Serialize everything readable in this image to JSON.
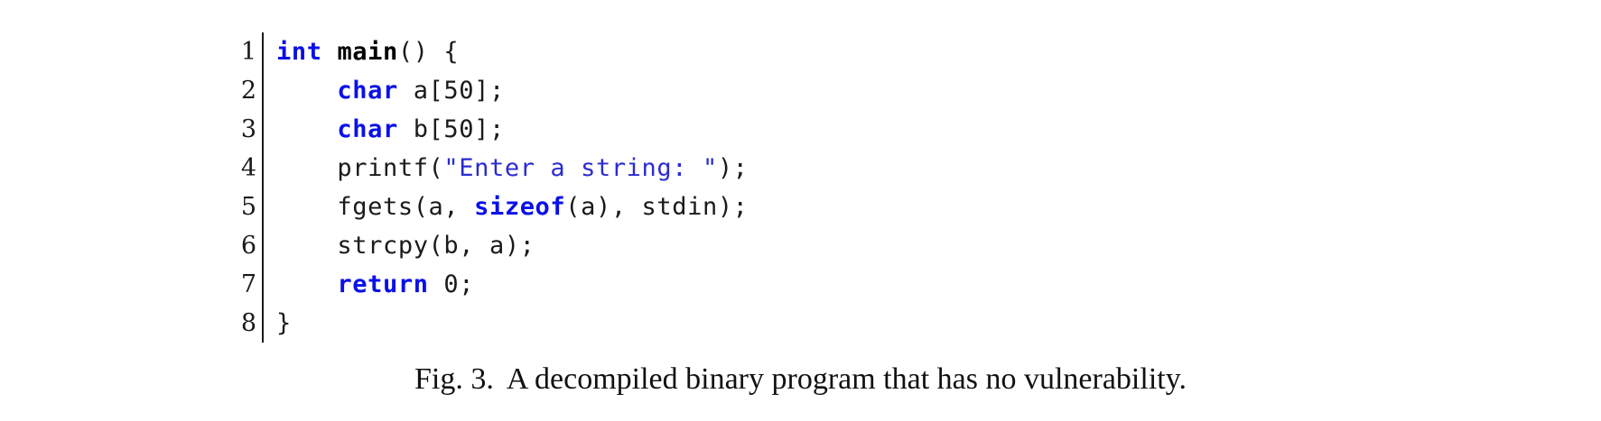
{
  "listing": {
    "lines": [
      {
        "number": "1",
        "tokens": [
          {
            "text": "int",
            "type": "kw"
          },
          {
            "text": " ",
            "type": "plain"
          },
          {
            "text": "main",
            "type": "fn"
          },
          {
            "text": "() {",
            "type": "plain"
          }
        ]
      },
      {
        "number": "2",
        "tokens": [
          {
            "text": "    ",
            "type": "plain"
          },
          {
            "text": "char",
            "type": "kw"
          },
          {
            "text": " a[50];",
            "type": "plain"
          }
        ]
      },
      {
        "number": "3",
        "tokens": [
          {
            "text": "    ",
            "type": "plain"
          },
          {
            "text": "char",
            "type": "kw"
          },
          {
            "text": " b[50];",
            "type": "plain"
          }
        ]
      },
      {
        "number": "4",
        "tokens": [
          {
            "text": "    printf(",
            "type": "plain"
          },
          {
            "text": "\"Enter a string: \"",
            "type": "str"
          },
          {
            "text": ");",
            "type": "plain"
          }
        ]
      },
      {
        "number": "5",
        "tokens": [
          {
            "text": "    fgets(a, ",
            "type": "plain"
          },
          {
            "text": "sizeof",
            "type": "kw"
          },
          {
            "text": "(a), stdin);",
            "type": "plain"
          }
        ]
      },
      {
        "number": "6",
        "tokens": [
          {
            "text": "    strcpy(b, a);",
            "type": "plain"
          }
        ]
      },
      {
        "number": "7",
        "tokens": [
          {
            "text": "    ",
            "type": "plain"
          },
          {
            "text": "return",
            "type": "kw"
          },
          {
            "text": " 0;",
            "type": "plain"
          }
        ]
      },
      {
        "number": "8",
        "tokens": [
          {
            "text": "}",
            "type": "plain"
          }
        ]
      }
    ]
  },
  "caption": {
    "label": "Fig. 3.",
    "text": "A decompiled binary program that has no vulnerability."
  },
  "colors": {
    "keyword": "#0a10e8",
    "string": "#2b2bd0",
    "text": "#1a1a1a"
  }
}
